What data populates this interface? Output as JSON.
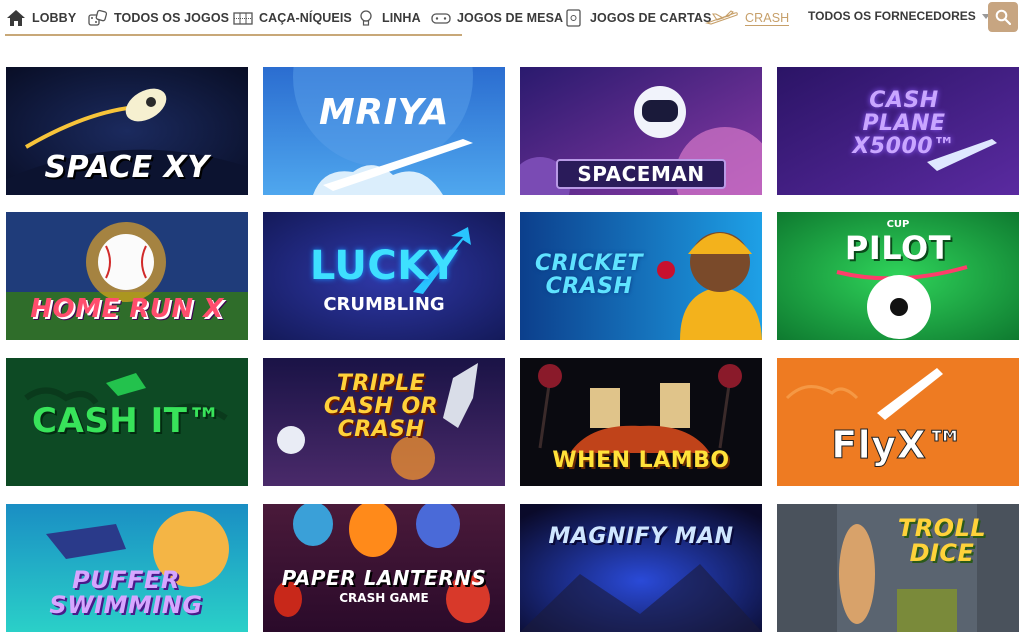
{
  "nav": {
    "items": [
      {
        "label": "LOBBY",
        "icon": "home-icon"
      },
      {
        "label": "TODOS OS JOGOS",
        "icon": "dice-icon"
      },
      {
        "label": "CAÇA-NÍQUEIS",
        "icon": "slot-machine-icon"
      },
      {
        "label": "LINHA",
        "icon": "lightbulb-icon"
      },
      {
        "label": "JOGOS DE MESA",
        "icon": "gamepad-icon"
      },
      {
        "label": "JOGOS DE CARTAS",
        "icon": "card-icon"
      },
      {
        "label": "CRASH",
        "icon": "plane-icon",
        "active": true
      }
    ],
    "providers_label": "TODOS OS FORNECEDORES",
    "search_icon": "search-icon",
    "accent": "#c7a581"
  },
  "games": [
    {
      "title": "SPACE XY"
    },
    {
      "title": "MRIYA"
    },
    {
      "title": "SPACEMAN"
    },
    {
      "title": "CASH PLANE X5000™"
    },
    {
      "title": "HOME RUN X"
    },
    {
      "title": "LUCKY",
      "subtitle": "CRUMBLING"
    },
    {
      "title": "CRICKET CRASH"
    },
    {
      "title": "PILOT",
      "badge": "CUP"
    },
    {
      "title": "CASH IT™"
    },
    {
      "title": "TRIPLE CASH OR CRASH"
    },
    {
      "title": "WHEN LAMBO"
    },
    {
      "title": "FlyX™"
    },
    {
      "title": "PUFFER SWIMMING"
    },
    {
      "title": "PAPER LANTERNS",
      "subtitle": "CRASH GAME"
    },
    {
      "title": "MAGNIFY MAN"
    },
    {
      "title": "TROLL DICE"
    }
  ]
}
